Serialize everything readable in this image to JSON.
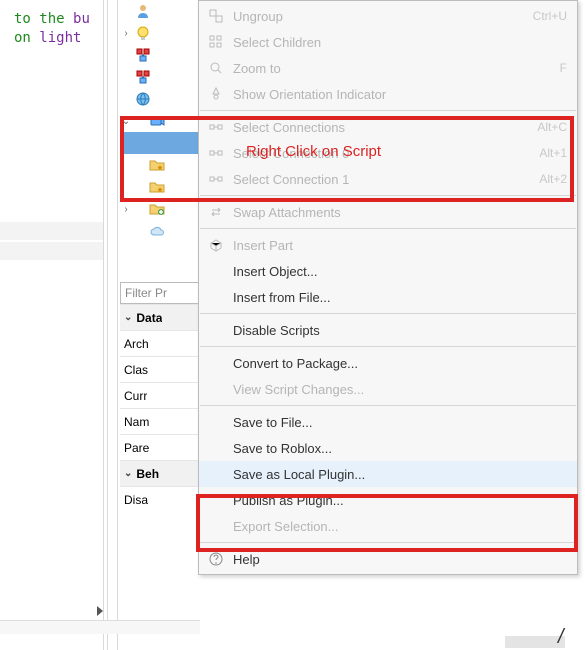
{
  "code_snippet": {
    "line1_a": "to the ",
    "line1_b": "bu",
    "line2_a": "on ",
    "line2_b": "light"
  },
  "tree": {
    "items": [
      {
        "icon": "person",
        "expand": ""
      },
      {
        "icon": "bulb",
        "expand": ">"
      },
      {
        "icon": "red-down",
        "expand": ""
      },
      {
        "icon": "red-down",
        "expand": ""
      },
      {
        "icon": "globe",
        "expand": ""
      },
      {
        "icon": "camera",
        "expand": "v",
        "selected_child": true
      },
      {
        "icon": "folder-star",
        "expand": ""
      },
      {
        "icon": "folder-star",
        "expand": ""
      },
      {
        "icon": "folder-plus",
        "expand": ">"
      },
      {
        "icon": "cloud",
        "expand": ""
      }
    ]
  },
  "filter_placeholder": "Filter Pr",
  "props": {
    "section1": "Data",
    "rows1": [
      "Arch",
      "Clas",
      "Curr",
      "Nam",
      "Pare"
    ],
    "section2": "Beh",
    "rows2": [
      "Disa"
    ]
  },
  "annotation": "Right Click on Script",
  "menu": {
    "groups": [
      [
        {
          "label": "Ungroup",
          "accel": "Ctrl+U",
          "icon": "ungroup",
          "disabled": true
        },
        {
          "label": "Select Children",
          "icon": "sel-children",
          "disabled": true
        },
        {
          "label": "Zoom to",
          "accel": "F",
          "icon": "zoom",
          "disabled": true
        },
        {
          "label": "Show Orientation Indicator",
          "icon": "orient",
          "disabled": true
        }
      ],
      [
        {
          "label": "Select Connections",
          "accel": "Alt+C",
          "icon": "sel-conn",
          "disabled": true
        },
        {
          "label": "Select Connection 0",
          "accel": "Alt+1",
          "icon": "sel-conn",
          "disabled": true
        },
        {
          "label": "Select Connection 1",
          "accel": "Alt+2",
          "icon": "sel-conn",
          "disabled": true
        }
      ],
      [
        {
          "label": "Swap Attachments",
          "icon": "swap",
          "disabled": true
        }
      ],
      [
        {
          "label": "Insert Part",
          "icon": "part",
          "disabled": true
        },
        {
          "label": "Insert Object...",
          "icon": "",
          "disabled": false
        },
        {
          "label": "Insert from File...",
          "icon": "",
          "disabled": false
        }
      ],
      [
        {
          "label": "Disable Scripts",
          "icon": "",
          "disabled": false
        }
      ],
      [
        {
          "label": "Convert to Package...",
          "icon": "",
          "disabled": false
        },
        {
          "label": "View Script Changes...",
          "icon": "",
          "disabled": true
        }
      ],
      [
        {
          "label": "Save to File...",
          "icon": "",
          "disabled": false
        },
        {
          "label": "Save to Roblox...",
          "icon": "",
          "disabled": false
        },
        {
          "label": "Save as Local Plugin...",
          "icon": "",
          "disabled": false,
          "hover": true
        },
        {
          "label": "Publish as Plugin...",
          "icon": "",
          "disabled": false
        },
        {
          "label": "Export Selection...",
          "icon": "",
          "disabled": true
        }
      ],
      [
        {
          "label": "Help",
          "icon": "help",
          "disabled": false
        }
      ]
    ]
  }
}
